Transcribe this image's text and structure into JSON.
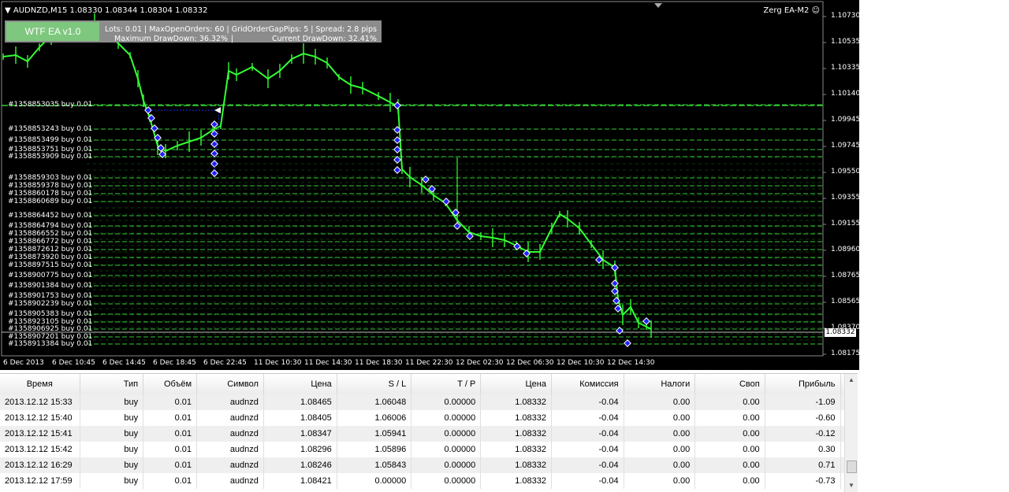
{
  "window": {
    "title": "AUDNZD,M15  1.08330 1.08344 1.08304 1.08332",
    "ea_name": "Zerg EA-M2 ☺"
  },
  "info_panel": {
    "badge": "WTF EA v1.0",
    "line1": "Lots: 0.01   |   MaxOpenOrders: 60   |   GridOrderGapPips: 5   |   Spread: 2.8 pips",
    "line2_left": "Maximum DrawDown: 36.32%",
    "line2_sep": "|",
    "line2_right": "Current DrawDown: 32.41%"
  },
  "tickets": [
    "#1358853035 buy 0.01",
    "#1358853243 buy 0.01",
    "#1358853499 buy 0.01",
    "#1358853751 buy 0.01",
    "#1358853909 buy 0.01",
    "#1358859303 buy 0.01",
    "#1358859378 buy 0.01",
    "#1358860178 buy 0.01",
    "#1358860689 buy 0.01",
    "#1358864452 buy 0.01",
    "#1358864794 buy 0.01",
    "#1358866552 buy 0.01",
    "#1358866772 buy 0.01",
    "#1358872612 buy 0.01",
    "#1358873920 buy 0.01",
    "#1358897515 buy 0.01",
    "#1358900775 buy 0.01",
    "#1358901384 buy 0.01",
    "#1358901753 buy 0.01",
    "#1358902239 buy 0.01",
    "#1358905383 buy 0.01",
    "#1358923105 buy 0.01",
    "#1358906925 buy 0.01",
    "#1358907201 buy 0.01",
    "#1358913384 buy 0.01"
  ],
  "price_axis": [
    "1.10730",
    "1.10535",
    "1.10335",
    "1.10140",
    "1.09945",
    "1.09745",
    "1.09550",
    "1.09355",
    "1.09155",
    "1.08960",
    "1.08765",
    "1.08565",
    "1.08370",
    "1.08175"
  ],
  "current_price": "1.08332",
  "time_axis": [
    "6 Dec 2013",
    "6 Dec 10:45",
    "6 Dec 14:45",
    "6 Dec 18:45",
    "6 Dec 22:45",
    "11 Dec 10:30",
    "11 Dec 14:30",
    "11 Dec 18:30",
    "11 Dec 22:30",
    "12 Dec 02:30",
    "12 Dec 06:30",
    "12 Dec 10:30",
    "12 Dec 14:30"
  ],
  "colors": {
    "candle": "#33ff33",
    "grid_line": "#33cc33",
    "marker": "#2020ff",
    "background": "#000000"
  },
  "table": {
    "headers": [
      "Время",
      "Тип",
      "Объём",
      "Символ",
      "Цена",
      "S / L",
      "T / P",
      "Цена",
      "Комиссия",
      "Налоги",
      "Своп",
      "Прибыль"
    ],
    "rows": [
      [
        "2013.12.12 15:33",
        "buy",
        "0.01",
        "audnzd",
        "1.08465",
        "1.06048",
        "0.00000",
        "1.08332",
        "-0.04",
        "0.00",
        "0.00",
        "-1.09"
      ],
      [
        "2013.12.12 15:40",
        "buy",
        "0.01",
        "audnzd",
        "1.08405",
        "1.06006",
        "0.00000",
        "1.08332",
        "-0.04",
        "0.00",
        "0.00",
        "-0.60"
      ],
      [
        "2013.12.12 15:41",
        "buy",
        "0.01",
        "audnzd",
        "1.08347",
        "1.05941",
        "0.00000",
        "1.08332",
        "-0.04",
        "0.00",
        "0.00",
        "-0.12"
      ],
      [
        "2013.12.12 15:42",
        "buy",
        "0.01",
        "audnzd",
        "1.08296",
        "1.05896",
        "0.00000",
        "1.08332",
        "-0.04",
        "0.00",
        "0.00",
        "0.30"
      ],
      [
        "2013.12.12 16:29",
        "buy",
        "0.01",
        "audnzd",
        "1.08246",
        "1.05843",
        "0.00000",
        "1.08332",
        "-0.04",
        "0.00",
        "0.00",
        "0.71"
      ],
      [
        "2013.12.12 17:59",
        "buy",
        "0.01",
        "audnzd",
        "1.08421",
        "0.00000",
        "0.00000",
        "1.08332",
        "-0.04",
        "0.00",
        "0.00",
        "-0.73"
      ]
    ]
  }
}
